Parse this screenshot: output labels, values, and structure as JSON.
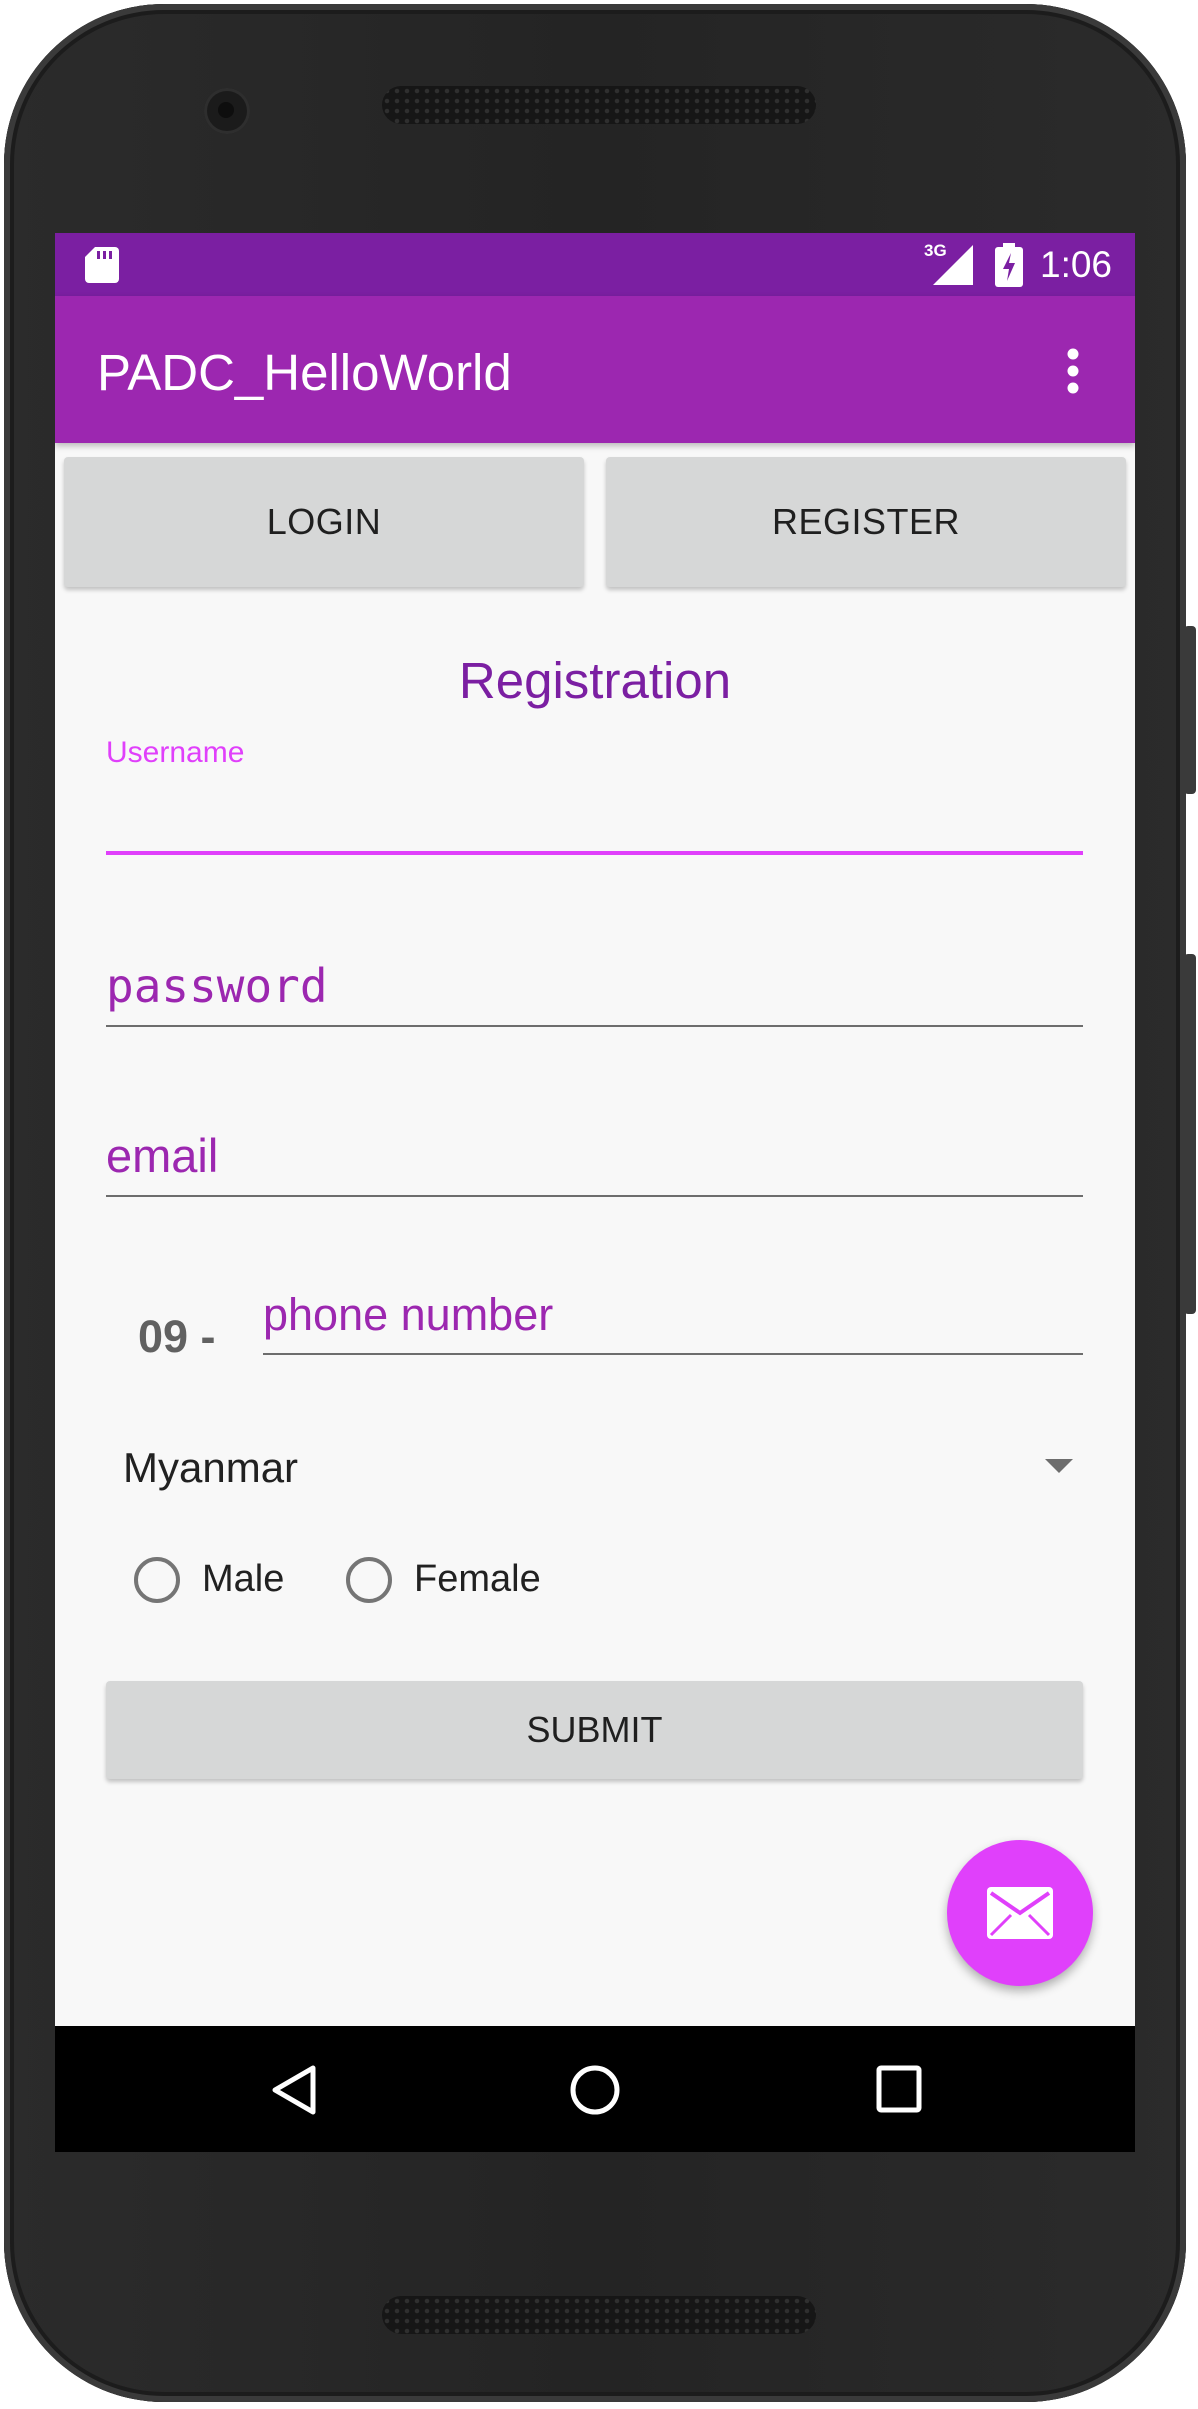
{
  "status_bar": {
    "time": "1:06",
    "network_type": "3G",
    "icons": [
      "sd-card-icon",
      "signal-icon",
      "battery-charging-icon"
    ]
  },
  "app_bar": {
    "title": "PADC_HelloWorld",
    "overflow_icon": "more-vert-icon"
  },
  "tabs": {
    "login_label": "LOGIN",
    "register_label": "REGISTER"
  },
  "form": {
    "heading": "Registration",
    "username": {
      "label": "Username",
      "value": ""
    },
    "password": {
      "placeholder": "password"
    },
    "email": {
      "placeholder": "email"
    },
    "phone": {
      "prefix": "09 -",
      "placeholder": "phone number"
    },
    "country": {
      "selected": "Myanmar"
    },
    "gender": {
      "options": [
        "Male",
        "Female"
      ],
      "selected": null
    },
    "submit_label": "SUBMIT"
  },
  "fab": {
    "icon": "email-icon"
  },
  "nav_bar": {
    "icons": [
      "back-icon",
      "home-icon",
      "recents-icon"
    ]
  },
  "colors": {
    "primary_dark": "#7b1fa2",
    "primary": "#9c27b0",
    "accent": "#e040fb"
  }
}
